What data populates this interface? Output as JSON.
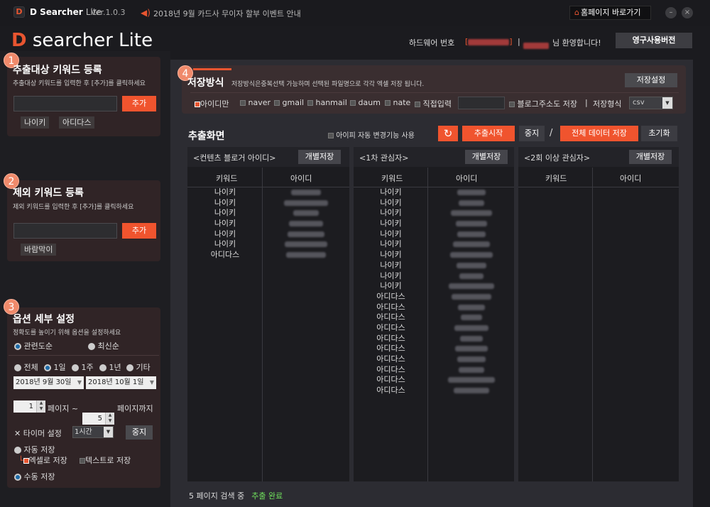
{
  "titlebar": {
    "app_name": "D Searcher",
    "app_lite": "Lite",
    "version": "Ver.1.0.3",
    "notice": "2018년 9월 카드사 무이자 할부 이벤트 안내",
    "home_button": "홈페이지 바로가기",
    "minimize": "–",
    "close": "×"
  },
  "header": {
    "brand_d": "D",
    "brand_rest": " searcher Lite",
    "hw_label": "하드웨어 번호",
    "welcome": "님 환영합니다!",
    "separator": "|",
    "bracket_open": "[",
    "bracket_close": "]",
    "perm_button": "영구사용버전"
  },
  "panel1": {
    "num": "1",
    "title": "추출대상 키워드 등록",
    "desc": "추출대상 키워드를 입력한 후 [추가]를 클릭하세요",
    "add_button": "추가",
    "chips": [
      "나이키",
      "아디다스"
    ]
  },
  "panel2": {
    "num": "2",
    "title": "제외 키워드 등록",
    "desc": "제외 키워드를 입력한 후 [추가]를 클릭하세요",
    "add_button": "추가",
    "chips": [
      "바람막이"
    ]
  },
  "panel3": {
    "num": "3",
    "title": "옵션 세부 설정",
    "desc": "정확도를 높이기 위해 옵션을 설정하세요",
    "sort_relevance": "관련도순",
    "sort_latest": "최신순",
    "period": [
      "전체",
      "1일",
      "1주",
      "1년",
      "기타"
    ],
    "date_from": "2018년   9월  30일",
    "date_to": "2018년  10월   1일",
    "page_from": "1",
    "page_to": "5",
    "page_label1": "페이지 ~",
    "page_label2": "페이지까지",
    "timer_label": "타이머 설정",
    "timer_value": "1시간",
    "stop_button": "중지",
    "auto_save": "자동 저장",
    "excel_save": "엑셀로 저장",
    "text_save": "텍스트로 저장",
    "manual_save": "수동 저장"
  },
  "save": {
    "num": "4",
    "title": "저장방식",
    "desc": "저장방식은중복선택 가능하며 선택된 파일명으로 각각 엑셀 저장 됩니다.",
    "settings_button": "저장설정",
    "options": [
      "아이디만",
      "naver",
      "gmail",
      "hanmail",
      "daum",
      "nate",
      "직접입력"
    ],
    "blog_save": "블로그주소도 저장",
    "format_sep": "|",
    "format_label": "저장형식",
    "format_value": "csv"
  },
  "extract": {
    "title": "추출화면",
    "auto_change": "아이피 자동 변경기능 사용",
    "start_button": "추출시작",
    "stop_button": "중지",
    "slash": "/",
    "save_all_button": "전체 데이터 저장",
    "reset_button": "초기화",
    "refresh_icon": "↻"
  },
  "columns": [
    {
      "title": "<컨텐츠 블로거 아이디>",
      "button": "개별저장",
      "h1": "키워드",
      "h2": "아이디",
      "keywords": [
        "나이키",
        "나이키",
        "나이키",
        "나이키",
        "나이키",
        "나이키",
        "아디다스"
      ]
    },
    {
      "title": "<1차 관심자>",
      "button": "개별저장",
      "h1": "키워드",
      "h2": "아이디",
      "keywords": [
        "나이키",
        "나이키",
        "나이키",
        "나이키",
        "나이키",
        "나이키",
        "나이키",
        "나이키",
        "나이키",
        "나이키",
        "아디다스",
        "아디다스",
        "아디다스",
        "아디다스",
        "아디다스",
        "아디다스",
        "아디다스",
        "아디다스",
        "아디다스",
        "아디다스"
      ]
    },
    {
      "title": "<2회 이상 관심자>",
      "button": "개별저장",
      "h1": "키워드",
      "h2": "아이디",
      "keywords": []
    }
  ],
  "status": {
    "search": "5 페이지 검색 중",
    "done": "추출 완료"
  },
  "colors": {
    "accent": "#e85530",
    "done": "#6fe05c"
  }
}
